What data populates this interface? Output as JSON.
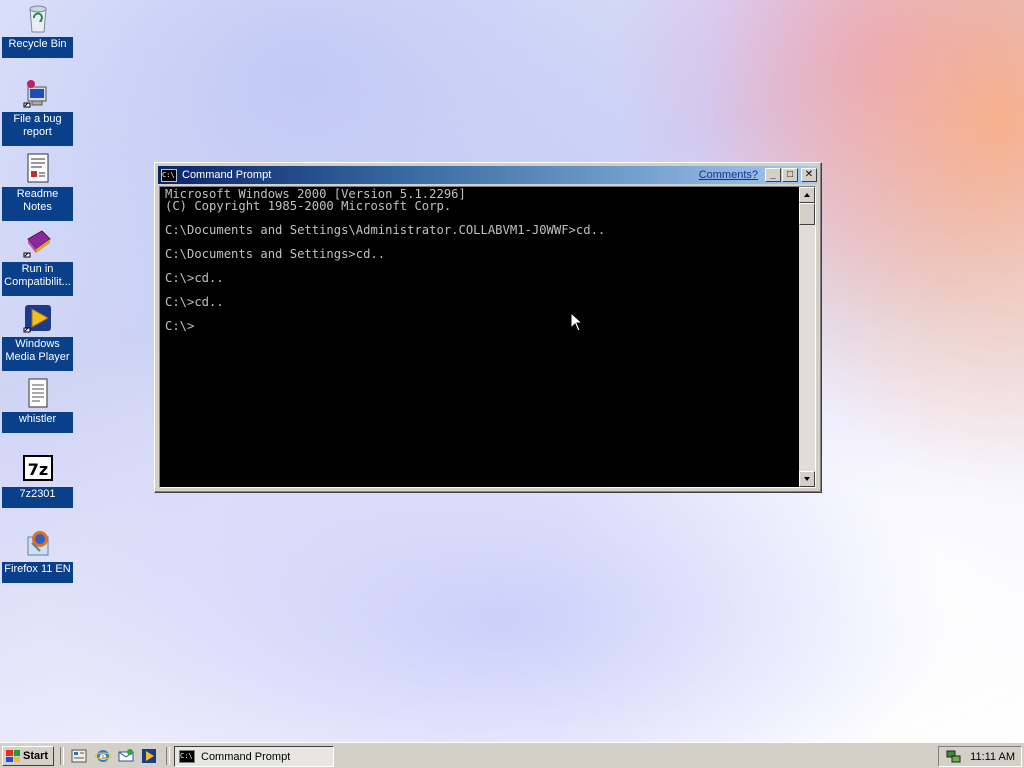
{
  "desktop": {
    "icons": [
      {
        "label": "Recycle Bin",
        "icon": "recycle-bin-icon"
      },
      {
        "label": "File a bug report",
        "icon": "bug-report-icon"
      },
      {
        "label": "Readme Notes",
        "icon": "readme-notes-icon"
      },
      {
        "label": "Run in Compatibilit...",
        "icon": "compatibility-icon"
      },
      {
        "label": "Windows Media Player",
        "icon": "media-player-icon"
      },
      {
        "label": "whistler",
        "icon": "text-document-icon"
      },
      {
        "label": "7z2301",
        "icon": "7zip-icon"
      },
      {
        "label": "Firefox 11 EN",
        "icon": "firefox-installer-icon"
      }
    ]
  },
  "window": {
    "title": "Command Prompt",
    "comments_link": "Comments?",
    "minimize": "_",
    "maximize": "□",
    "close": "✕",
    "console_lines": [
      "Microsoft Windows 2000 [Version 5.1.2296]",
      "(C) Copyright 1985-2000 Microsoft Corp.",
      "",
      "C:\\Documents and Settings\\Administrator.COLLABVM1-J0WWF>cd..",
      "",
      "C:\\Documents and Settings>cd..",
      "",
      "C:\\>cd..",
      "",
      "C:\\>cd..",
      "",
      "C:\\>"
    ],
    "colors": {
      "console_bg": "#000000",
      "console_fg": "#c0c0c0",
      "title_start": "#0a246a",
      "title_end": "#a6caf0"
    }
  },
  "taskbar": {
    "start_label": "Start",
    "quick_launch": [
      "show-desktop-icon",
      "internet-explorer-icon",
      "outlook-express-icon",
      "media-player-icon"
    ],
    "tasks": [
      {
        "label": "Command Prompt",
        "icon": "command-prompt-icon",
        "active": true
      }
    ],
    "clock": "11:11 AM"
  }
}
